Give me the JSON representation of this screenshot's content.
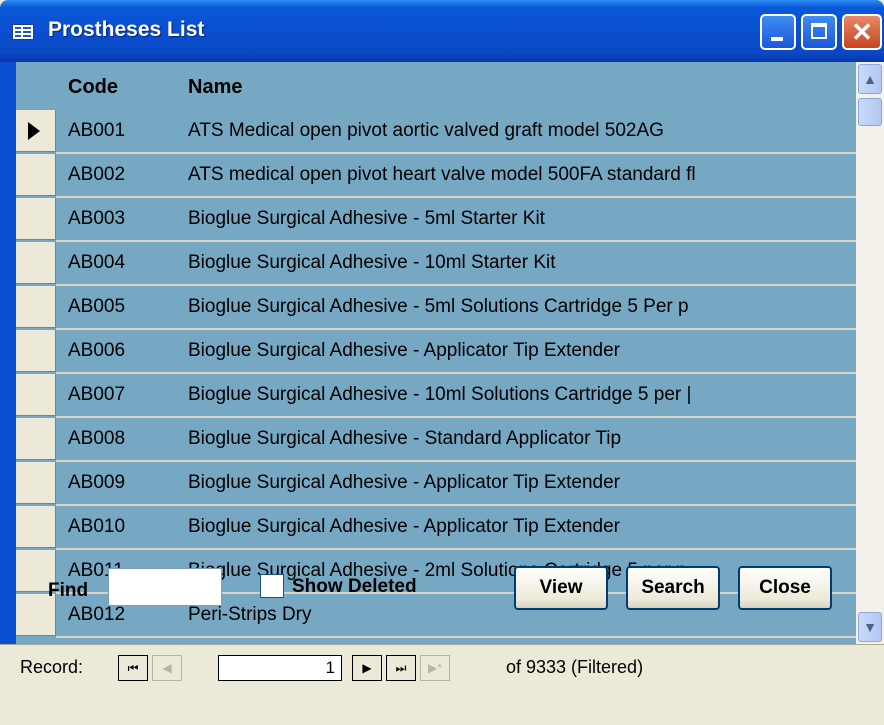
{
  "window": {
    "title": "Prostheses List"
  },
  "grid": {
    "headers": {
      "code": "Code",
      "name": "Name"
    },
    "rows": [
      {
        "code": "AB001",
        "name": "ATS Medical open pivot aortic valved graft model 502AG",
        "current": true
      },
      {
        "code": "AB002",
        "name": "ATS medical open pivot heart valve model 500FA standard fl"
      },
      {
        "code": "AB003",
        "name": "Bioglue Surgical Adhesive - 5ml Starter Kit"
      },
      {
        "code": "AB004",
        "name": "Bioglue Surgical Adhesive - 10ml Starter Kit"
      },
      {
        "code": "AB005",
        "name": "Bioglue Surgical Adhesive - 5ml Solutions Cartridge 5 Per p"
      },
      {
        "code": "AB006",
        "name": "Bioglue Surgical Adhesive - Applicator Tip Extender"
      },
      {
        "code": "AB007",
        "name": "Bioglue Surgical Adhesive - 10ml Solutions Cartridge 5 per |"
      },
      {
        "code": "AB008",
        "name": "Bioglue Surgical Adhesive - Standard Applicator Tip"
      },
      {
        "code": "AB009",
        "name": "Bioglue Surgical Adhesive - Applicator Tip Extender"
      },
      {
        "code": "AB010",
        "name": "Bioglue Surgical Adhesive - Applicator Tip Extender"
      },
      {
        "code": "AB011",
        "name": "Bioglue Surgical Adhesive - 2ml Solutions Cartridge  5 per p"
      },
      {
        "code": "AB012",
        "name": "Peri-Strips Dry"
      }
    ]
  },
  "footer": {
    "find_label": "Find",
    "find_value": "",
    "show_deleted_label": "Show Deleted",
    "show_deleted_checked": false,
    "view_label": "View",
    "search_label": "Search",
    "close_label": "Close"
  },
  "navigation": {
    "record_label": "Record:",
    "current_record": "1",
    "of_text": "of  9333 (Filtered)"
  },
  "colors": {
    "form_background": "#76a8c3",
    "titlebar": "#0a4fd0"
  }
}
